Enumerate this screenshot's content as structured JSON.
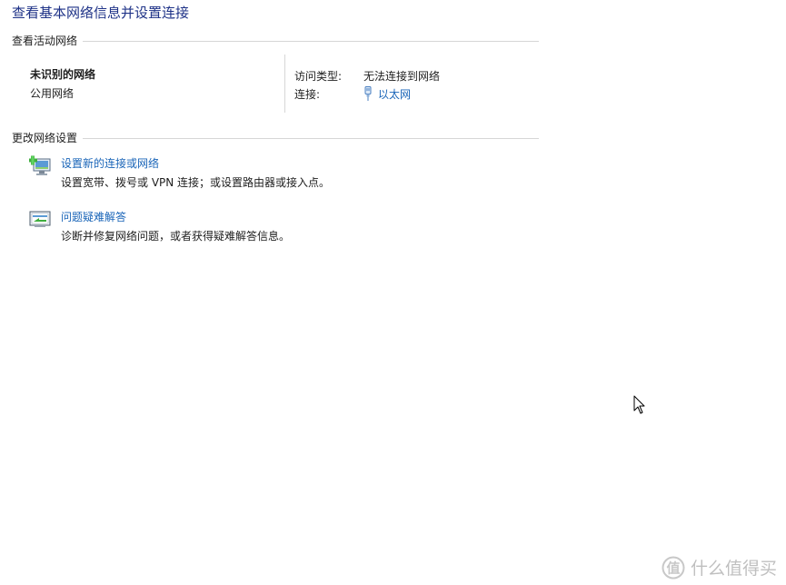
{
  "page": {
    "title": "查看基本网络信息并设置连接"
  },
  "active_networks": {
    "header": "查看活动网络",
    "network_name": "未识别的网络",
    "network_category": "公用网络",
    "access_type_label": "访问类型:",
    "access_type_value": "无法连接到网络",
    "connections_label": "连接:",
    "connections_value": "以太网",
    "connections_icon": "ethernet-plug-icon"
  },
  "change_settings": {
    "header": "更改网络设置",
    "tasks": [
      {
        "link": "设置新的连接或网络",
        "description": "设置宽带、拨号或 VPN 连接；或设置路由器或接入点。",
        "icon": "new-connection-icon"
      },
      {
        "link": "问题疑难解答",
        "description": "诊断并修复网络问题，或者获得疑难解答信息。",
        "icon": "troubleshoot-icon"
      }
    ]
  },
  "watermark": {
    "text": "什么值得买",
    "icon": "smzdm-logo-icon"
  },
  "colors": {
    "title": "#1e3287",
    "link": "#1a65b8",
    "divider": "#d6d6d6"
  }
}
